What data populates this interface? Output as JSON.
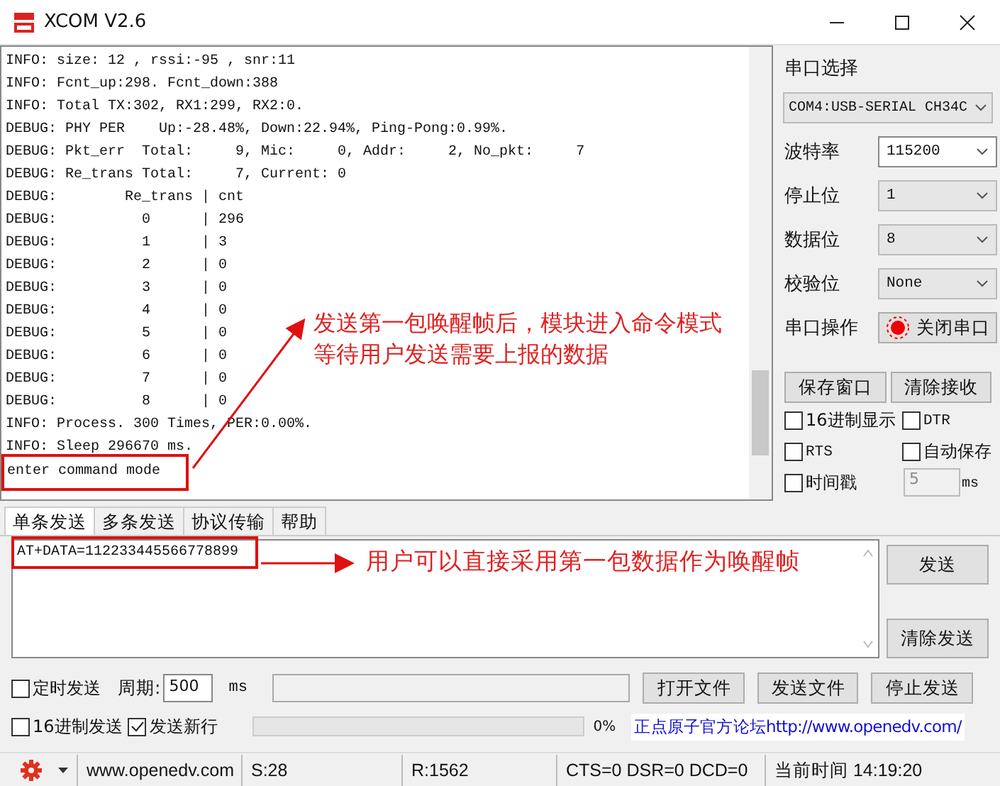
{
  "window": {
    "title": "XCOM V2.6"
  },
  "log": {
    "lines": [
      "INFO: size: 12 , rssi:-95 , snr:11",
      "INFO: Fcnt_up:298. Fcnt_down:388",
      "INFO: Total TX:302, RX1:299, RX2:0.",
      "DEBUG: PHY PER    Up:-28.48%, Down:22.94%, Ping-Pong:0.99%.",
      "DEBUG: Pkt_err  Total:     9, Mic:     0, Addr:     2, No_pkt:     7",
      "DEBUG: Re_trans Total:     7, Current: 0",
      "DEBUG:        Re_trans | cnt",
      "DEBUG:          0      | 296",
      "DEBUG:          1      | 3",
      "DEBUG:          2      | 0",
      "DEBUG:          3      | 0",
      "DEBUG:          4      | 0",
      "DEBUG:          5      | 0",
      "DEBUG:          6      | 0",
      "DEBUG:          7      | 0",
      "DEBUG:          8      | 0",
      "INFO: Process. 300 Times, PER:0.00%.",
      "INFO: Sleep 296670 ms.",
      "enter command mode"
    ]
  },
  "port_panel": {
    "title": "串口选择",
    "port": "COM4:USB-SERIAL CH34C",
    "settings": [
      {
        "label": "波特率",
        "value": "115200"
      },
      {
        "label": "停止位",
        "value": "1"
      },
      {
        "label": "数据位",
        "value": "8"
      },
      {
        "label": "校验位",
        "value": "None"
      }
    ],
    "operation_label": "串口操作",
    "open_button": "关闭串口",
    "open": true,
    "buttons": [
      "保存窗口",
      "清除接收"
    ],
    "options": [
      {
        "label": "16进制显示",
        "checked": false
      },
      {
        "label": "DTR",
        "checked": false
      },
      {
        "label": "RTS",
        "checked": false
      },
      {
        "label": "自动保存",
        "checked": false
      },
      {
        "label": "时间戳",
        "checked": false
      }
    ],
    "timestamp_value": "5",
    "timestamp_unit": "ms"
  },
  "tabs": [
    {
      "label": "单条发送",
      "selected": true
    },
    {
      "label": "多条发送",
      "selected": false
    },
    {
      "label": "协议传输",
      "selected": false
    },
    {
      "label": "帮助",
      "selected": false
    }
  ],
  "send": {
    "value": "AT+DATA=112233445566778899",
    "buttons": [
      "发送",
      "清除发送"
    ],
    "timed_send": {
      "label": "定时发送",
      "checked": false
    },
    "period_label": "周期:",
    "period": "500",
    "period_unit": "ms",
    "file_buttons": [
      "打开文件",
      "发送文件",
      "停止发送"
    ],
    "hex_send": {
      "label": "16进制发送",
      "checked": false
    },
    "newline": {
      "label": "发送新行",
      "checked": true
    },
    "progress": {
      "level": 0,
      "reading": "0%"
    },
    "forum_link": "正点原子官方论坛http://www.openedv.com/"
  },
  "status_bar": {
    "url": "www.openedv.com",
    "sent": "S:28",
    "received": "R:1562",
    "lines": "CTS=0 DSR=0 DCD=0",
    "time": "当前时间 14:19:20"
  },
  "annotations": [
    {
      "lines": [
        "发送第一包唤醒帧后，模块进入命令模式",
        "等待用户发送需要上报的数据"
      ]
    },
    {
      "lines": [
        "用户可以直接采用第一包数据作为唤醒帧"
      ]
    }
  ]
}
